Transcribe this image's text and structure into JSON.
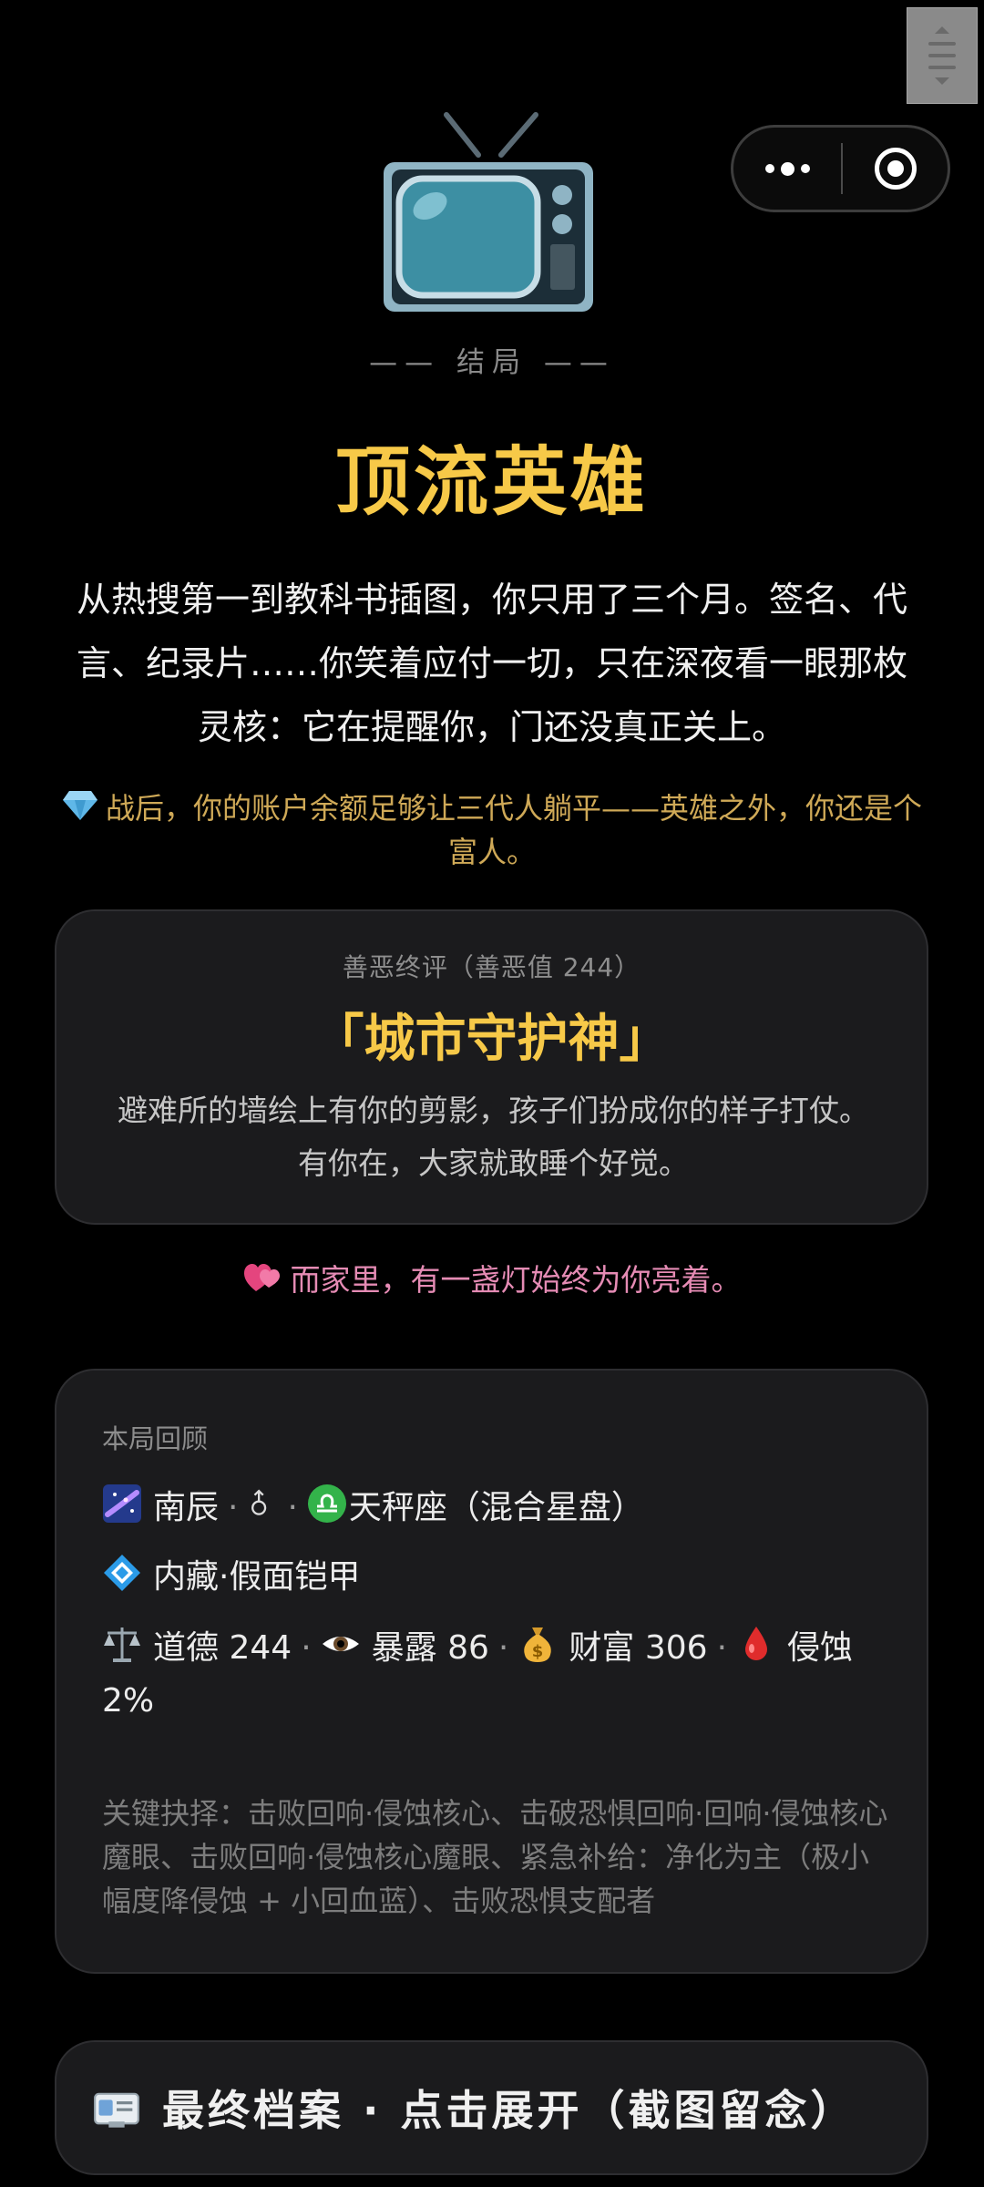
{
  "ending": {
    "label": "—— 结局 ——",
    "title": "顶流英雄",
    "description": "从热搜第一到教科书插图，你只用了三个月。签名、代言、纪录片……你笑着应付一切，只在深夜看一眼那枚灵核：它在提醒你，门还没真正关上。",
    "wealth_note": "战后，你的账户余额足够让三代人躺平——英雄之外，你还是个富人。"
  },
  "judgement": {
    "caption": "善恶终评（善恶值 244）",
    "title": "「城市守护神」",
    "text": "避难所的墙绘上有你的剪影，孩子们扮成你的样子打仗。有你在，大家就敢睡个好觉。"
  },
  "family_note": "而家里，有一盏灯始终为你亮着。",
  "review": {
    "title": "本局回顾",
    "identity": {
      "name": "南辰",
      "zodiac": "天秤座（混合星盘）"
    },
    "trait": "内藏·假面铠甲",
    "stats": {
      "morality_label": "道德",
      "morality": "244",
      "exposure_label": "暴露",
      "exposure": "86",
      "wealth_label": "财富",
      "wealth": "306",
      "corrosion_label": "侵蚀",
      "corrosion": "2%"
    },
    "key_choices": "关键抉择：击败回响·侵蚀核心、击破恐惧回响·回响·侵蚀核心魔眼、击败回响·侵蚀核心魔眼、紧急补给：净化为主（极小幅度降侵蚀 + 小回血蓝）、击败恐惧支配者"
  },
  "archive_button": {
    "label": "最终档案 · 点击展开（截图留念）"
  },
  "colors": {
    "background": "#000000",
    "accent_gold": "#f7c948",
    "wealth_gold": "#cfa957",
    "pink": "#e58bb4",
    "card_bg": "#1b1b1d"
  },
  "icons": [
    "tv-icon",
    "gem-icon",
    "heart-icon",
    "galaxy-icon",
    "male-icon",
    "libra-icon",
    "diamond-icon",
    "scales-icon",
    "eye-icon",
    "money-bag-icon",
    "blood-drop-icon",
    "id-card-icon",
    "more-icon",
    "close-icon"
  ]
}
